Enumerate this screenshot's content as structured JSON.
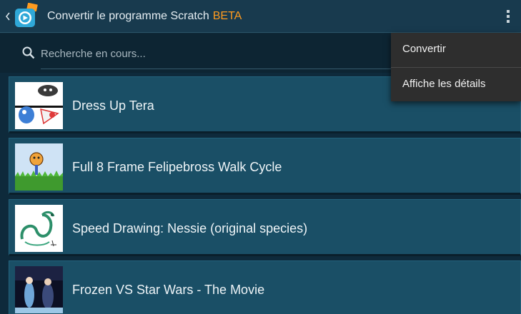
{
  "app": {
    "title": "Convertir le programme Scratch",
    "beta_label": "BETA",
    "accent_color": "#ff9b1f",
    "icon": "scratch-camera-icon"
  },
  "search": {
    "placeholder": "Recherche en cours...",
    "value": ""
  },
  "menu": {
    "items": [
      {
        "label": "Convertir"
      },
      {
        "label": "Affiche les détails"
      }
    ]
  },
  "projects": [
    {
      "title": "Dress Up Tera",
      "thumbnail": "dress-up-tera-thumbnail"
    },
    {
      "title": "Full 8 Frame Felipebross Walk Cycle",
      "thumbnail": "walk-cycle-thumbnail"
    },
    {
      "title": "Speed Drawing: Nessie (original species)",
      "thumbnail": "nessie-drawing-thumbnail"
    },
    {
      "title": "Frozen VS Star Wars - The Movie",
      "thumbnail": "frozen-star-wars-thumbnail"
    }
  ]
}
